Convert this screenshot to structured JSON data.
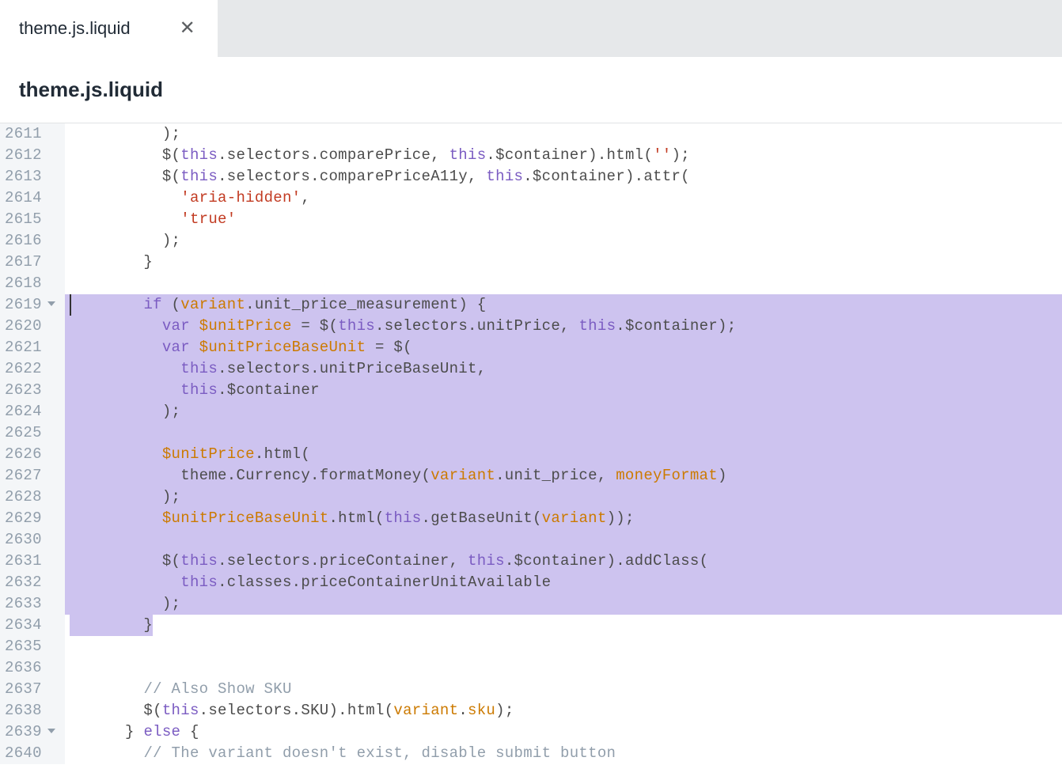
{
  "tab": {
    "label": "theme.js.liquid"
  },
  "filename": "theme.js.liquid",
  "gutter_start": 2611,
  "gutter_end": 2640,
  "fold_lines": [
    2619,
    2639
  ],
  "highlight_full": [
    2619,
    2620,
    2621,
    2622,
    2623,
    2624,
    2625,
    2626,
    2627,
    2628,
    2629,
    2630,
    2631,
    2632,
    2633
  ],
  "code": {
    "l2611": [
      {
        "c": "p",
        "t": "          );"
      }
    ],
    "l2612": [
      {
        "c": "p",
        "t": "          $("
      },
      {
        "c": "kw",
        "t": "this"
      },
      {
        "c": "p",
        "t": ".selectors.comparePrice, "
      },
      {
        "c": "kw",
        "t": "this"
      },
      {
        "c": "p",
        "t": ".$container).html("
      },
      {
        "c": "st",
        "t": "''"
      },
      {
        "c": "p",
        "t": ");"
      }
    ],
    "l2613": [
      {
        "c": "p",
        "t": "          $("
      },
      {
        "c": "kw",
        "t": "this"
      },
      {
        "c": "p",
        "t": ".selectors.comparePriceA11y, "
      },
      {
        "c": "kw",
        "t": "this"
      },
      {
        "c": "p",
        "t": ".$container).attr("
      }
    ],
    "l2614": [
      {
        "c": "p",
        "t": "            "
      },
      {
        "c": "st",
        "t": "'aria-hidden'"
      },
      {
        "c": "p",
        "t": ","
      }
    ],
    "l2615": [
      {
        "c": "p",
        "t": "            "
      },
      {
        "c": "st",
        "t": "'true'"
      }
    ],
    "l2616": [
      {
        "c": "p",
        "t": "          );"
      }
    ],
    "l2617": [
      {
        "c": "p",
        "t": "        }"
      }
    ],
    "l2618": [
      {
        "c": "p",
        "t": ""
      }
    ],
    "l2619": [
      {
        "c": "p",
        "t": "        "
      },
      {
        "c": "kw",
        "t": "if"
      },
      {
        "c": "p",
        "t": " ("
      },
      {
        "c": "v",
        "t": "variant"
      },
      {
        "c": "p",
        "t": ".unit_price_measurement) {"
      }
    ],
    "l2620": [
      {
        "c": "p",
        "t": "          "
      },
      {
        "c": "kw",
        "t": "var"
      },
      {
        "c": "p",
        "t": " "
      },
      {
        "c": "v",
        "t": "$unitPrice"
      },
      {
        "c": "p",
        "t": " = $("
      },
      {
        "c": "kw",
        "t": "this"
      },
      {
        "c": "p",
        "t": ".selectors.unitPrice, "
      },
      {
        "c": "kw",
        "t": "this"
      },
      {
        "c": "p",
        "t": ".$container);"
      }
    ],
    "l2621": [
      {
        "c": "p",
        "t": "          "
      },
      {
        "c": "kw",
        "t": "var"
      },
      {
        "c": "p",
        "t": " "
      },
      {
        "c": "v",
        "t": "$unitPriceBaseUnit"
      },
      {
        "c": "p",
        "t": " = $("
      }
    ],
    "l2622": [
      {
        "c": "p",
        "t": "            "
      },
      {
        "c": "kw",
        "t": "this"
      },
      {
        "c": "p",
        "t": ".selectors.unitPriceBaseUnit,"
      }
    ],
    "l2623": [
      {
        "c": "p",
        "t": "            "
      },
      {
        "c": "kw",
        "t": "this"
      },
      {
        "c": "p",
        "t": ".$container"
      }
    ],
    "l2624": [
      {
        "c": "p",
        "t": "          );"
      }
    ],
    "l2625": [
      {
        "c": "p",
        "t": ""
      }
    ],
    "l2626": [
      {
        "c": "p",
        "t": "          "
      },
      {
        "c": "v",
        "t": "$unitPrice"
      },
      {
        "c": "p",
        "t": ".html("
      }
    ],
    "l2627": [
      {
        "c": "p",
        "t": "            theme.Currency.formatMoney("
      },
      {
        "c": "v",
        "t": "variant"
      },
      {
        "c": "p",
        "t": ".unit_price, "
      },
      {
        "c": "v",
        "t": "moneyFormat"
      },
      {
        "c": "p",
        "t": ")"
      }
    ],
    "l2628": [
      {
        "c": "p",
        "t": "          );"
      }
    ],
    "l2629": [
      {
        "c": "p",
        "t": "          "
      },
      {
        "c": "v",
        "t": "$unitPriceBaseUnit"
      },
      {
        "c": "p",
        "t": ".html("
      },
      {
        "c": "kw",
        "t": "this"
      },
      {
        "c": "p",
        "t": ".getBaseUnit("
      },
      {
        "c": "v",
        "t": "variant"
      },
      {
        "c": "p",
        "t": "));"
      }
    ],
    "l2630": [
      {
        "c": "p",
        "t": ""
      }
    ],
    "l2631": [
      {
        "c": "p",
        "t": "          $("
      },
      {
        "c": "kw",
        "t": "this"
      },
      {
        "c": "p",
        "t": ".selectors.priceContainer, "
      },
      {
        "c": "kw",
        "t": "this"
      },
      {
        "c": "p",
        "t": ".$container).addClass("
      }
    ],
    "l2632": [
      {
        "c": "p",
        "t": "            "
      },
      {
        "c": "kw",
        "t": "this"
      },
      {
        "c": "p",
        "t": ".classes.priceContainerUnitAvailable"
      }
    ],
    "l2633": [
      {
        "c": "p",
        "t": "          );"
      }
    ],
    "l2634": [
      {
        "c": "p",
        "t": "        }"
      }
    ],
    "l2635": [
      {
        "c": "p",
        "t": ""
      }
    ],
    "l2636": [
      {
        "c": "p",
        "t": ""
      }
    ],
    "l2637": [
      {
        "c": "p",
        "t": "        "
      },
      {
        "c": "cm",
        "t": "// Also Show SKU"
      }
    ],
    "l2638": [
      {
        "c": "p",
        "t": "        $("
      },
      {
        "c": "kw",
        "t": "this"
      },
      {
        "c": "p",
        "t": ".selectors.SKU).html("
      },
      {
        "c": "v",
        "t": "variant"
      },
      {
        "c": "p",
        "t": "."
      },
      {
        "c": "v",
        "t": "sku"
      },
      {
        "c": "p",
        "t": ");"
      }
    ],
    "l2639": [
      {
        "c": "p",
        "t": "      } "
      },
      {
        "c": "kw",
        "t": "else"
      },
      {
        "c": "p",
        "t": " {"
      }
    ],
    "l2640": [
      {
        "c": "p",
        "t": "        "
      },
      {
        "c": "cm",
        "t": "// The variant doesn't exist, disable submit button"
      }
    ]
  }
}
